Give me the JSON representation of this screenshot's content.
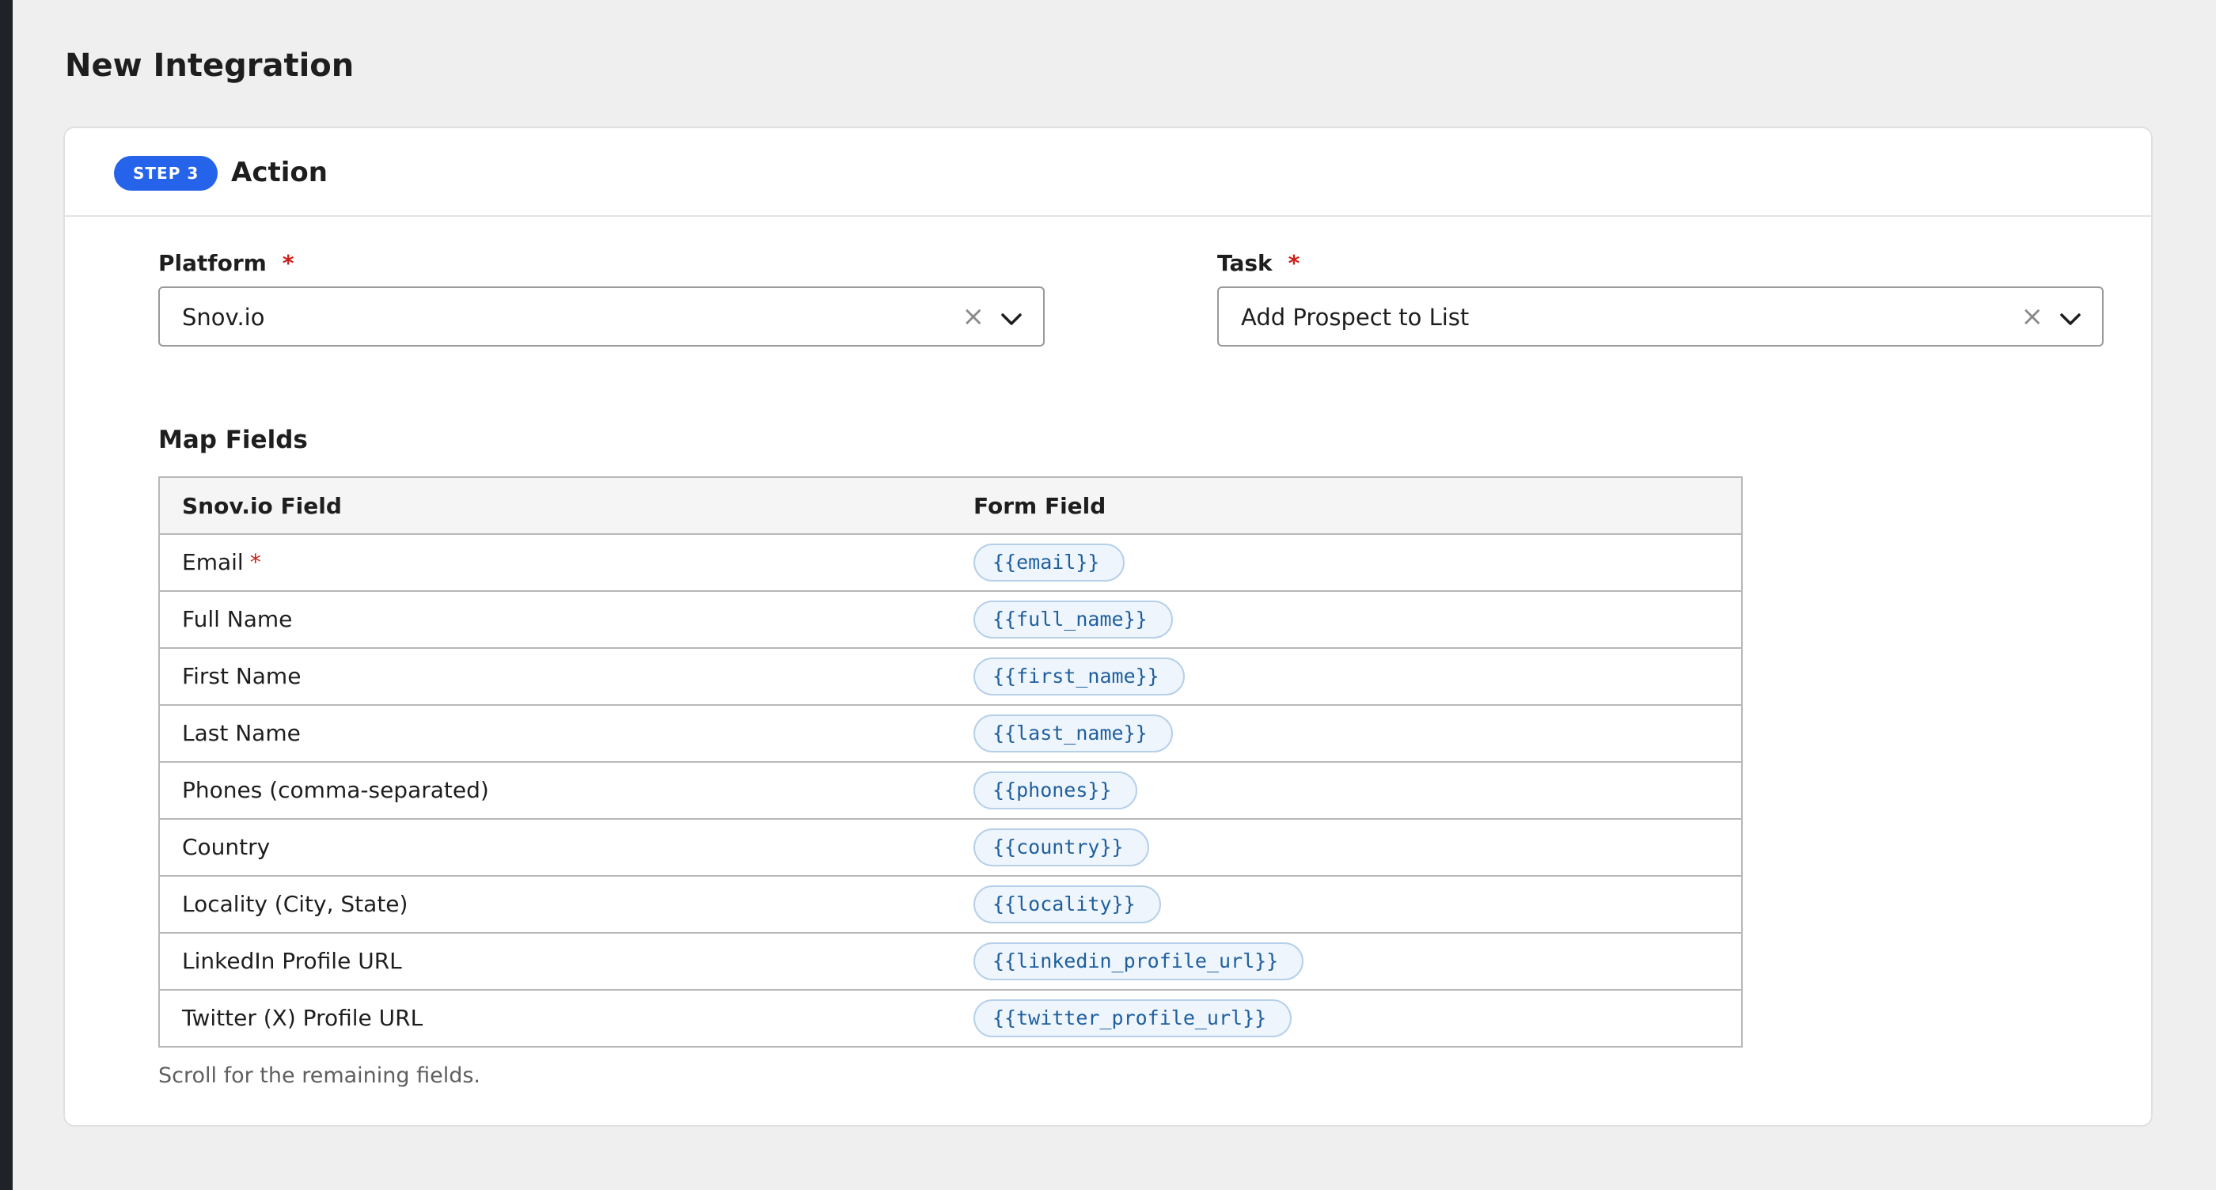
{
  "page": {
    "title": "New Integration"
  },
  "step": {
    "badge": "STEP 3",
    "title": "Action"
  },
  "platform": {
    "label": "Platform",
    "required": "*",
    "value": "Snov.io",
    "clear": "×"
  },
  "task": {
    "label": "Task",
    "required": "*",
    "value": "Add Prospect to List",
    "clear": "×"
  },
  "map_fields": {
    "title": "Map Fields",
    "col_service": "Snov.io Field",
    "col_form": "Form Field",
    "rows": [
      {
        "label": "Email",
        "required": "*",
        "token": "{{email}}"
      },
      {
        "label": "Full Name",
        "token": "{{full_name}}"
      },
      {
        "label": "First Name",
        "token": "{{first_name}}"
      },
      {
        "label": "Last Name",
        "token": "{{last_name}}"
      },
      {
        "label": "Phones (comma-separated)",
        "token": "{{phones}}"
      },
      {
        "label": "Country",
        "token": "{{country}}"
      },
      {
        "label": "Locality (City, State)",
        "token": "{{locality}}"
      },
      {
        "label": "LinkedIn Profile URL",
        "token": "{{linkedin_profile_url}}"
      },
      {
        "label": "Twitter (X) Profile URL",
        "token": "{{twitter_profile_url}}"
      }
    ],
    "hint": "Scroll for the remaining fields."
  },
  "icons": {
    "clear": "close-icon",
    "dropdown": "chevron-down-icon"
  },
  "colors": {
    "accent": "#2563eb",
    "required": "#cc1f1a",
    "token_text": "#1f5f9e",
    "token_bg": "#eef5fc",
    "token_border": "#b6d0ea"
  }
}
